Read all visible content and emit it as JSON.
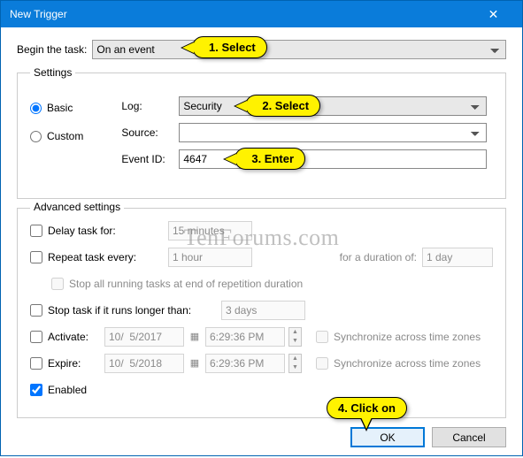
{
  "window": {
    "title": "New Trigger"
  },
  "beginLabel": "Begin the task:",
  "beginValue": "On an event",
  "settings": {
    "legend": "Settings",
    "basicLabel": "Basic",
    "customLabel": "Custom",
    "logLabel": "Log:",
    "logValue": "Security",
    "sourceLabel": "Source:",
    "sourceValue": "",
    "eventIdLabel": "Event ID:",
    "eventIdValue": "4647"
  },
  "advanced": {
    "title": "Advanced settings",
    "delayLabel": "Delay task for:",
    "delayValue": "15 minutes",
    "repeatLabel": "Repeat task every:",
    "repeatValue": "1 hour",
    "durationLabel": "for a duration of:",
    "durationValue": "1 day",
    "stopAllLabel": "Stop all running tasks at end of repetition duration",
    "stopIfLabel": "Stop task if it runs longer than:",
    "stopIfValue": "3 days",
    "activateLabel": "Activate:",
    "activateDate": "10/  5/2017",
    "activateTime": "6:29:36 PM",
    "expireLabel": "Expire:",
    "expireDate": "10/  5/2018",
    "expireTime": "6:29:36 PM",
    "syncLabel": "Synchronize across time zones",
    "enabledLabel": "Enabled"
  },
  "buttons": {
    "ok": "OK",
    "cancel": "Cancel"
  },
  "callouts": {
    "c1": "1. Select",
    "c2": "2. Select",
    "c3": "3. Enter",
    "c4": "4. Click on"
  },
  "watermark": "TenForums.com"
}
